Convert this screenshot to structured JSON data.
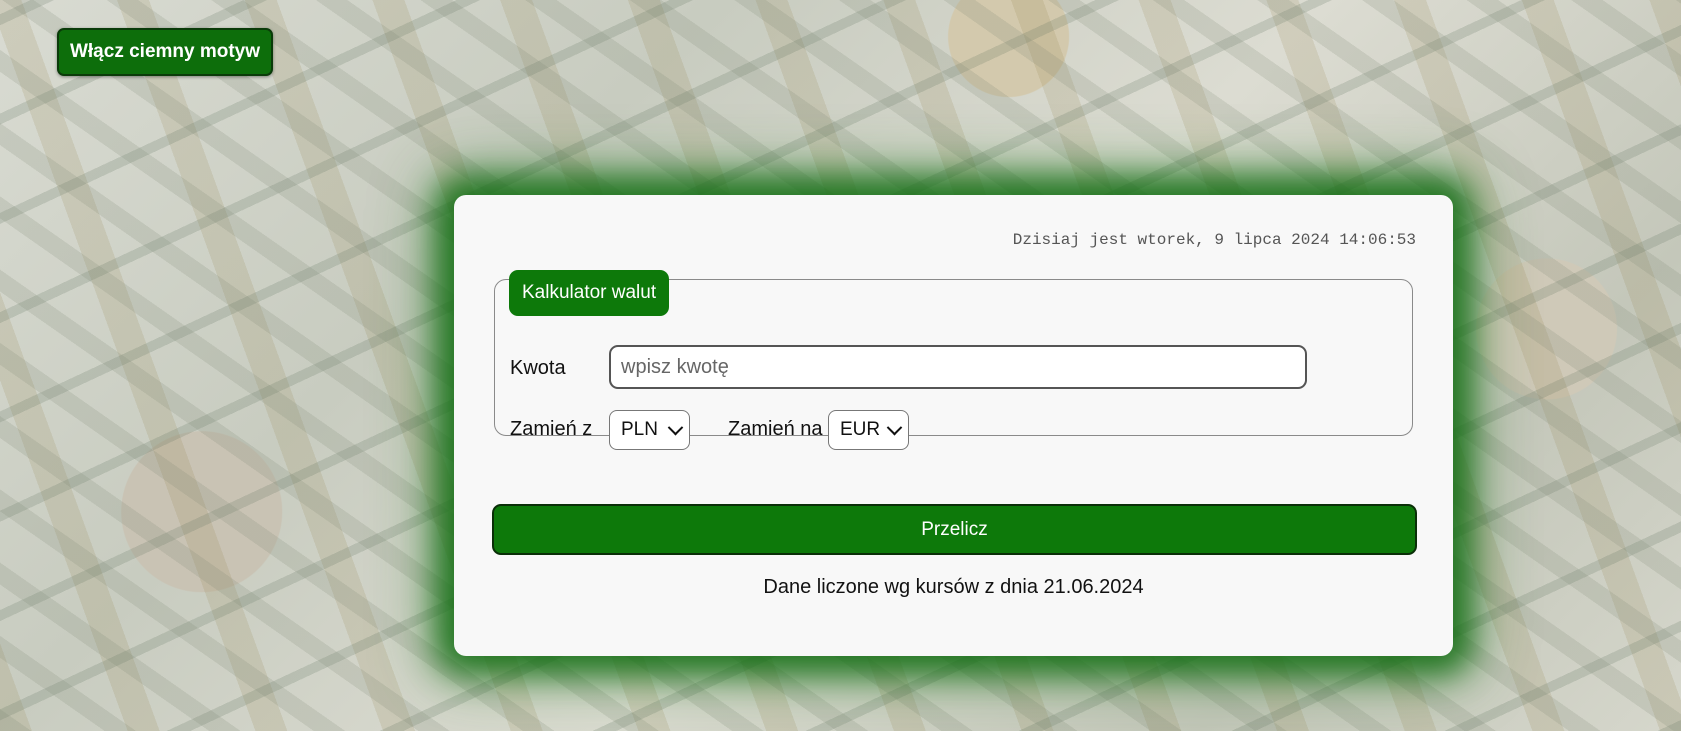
{
  "theme_toggle": {
    "label": "Włącz ciemny motyw"
  },
  "datetime": "Dzisiaj jest wtorek, 9 lipca 2024 14:06:53",
  "converter": {
    "legend": "Kalkulator walut",
    "amount_label": "Kwota",
    "amount_placeholder": "wpisz kwotę",
    "amount_value": "",
    "from_label": "Zamień z",
    "from_value": "PLN",
    "to_label": "Zamień na",
    "to_value": "EUR",
    "submit_label": "Przelicz"
  },
  "rates_note": "Dane liczone wg kursów z dnia 21.06.2024",
  "colors": {
    "primary_green": "#0d790a",
    "card_background": "#f8f8f8",
    "glow": "#147014"
  }
}
